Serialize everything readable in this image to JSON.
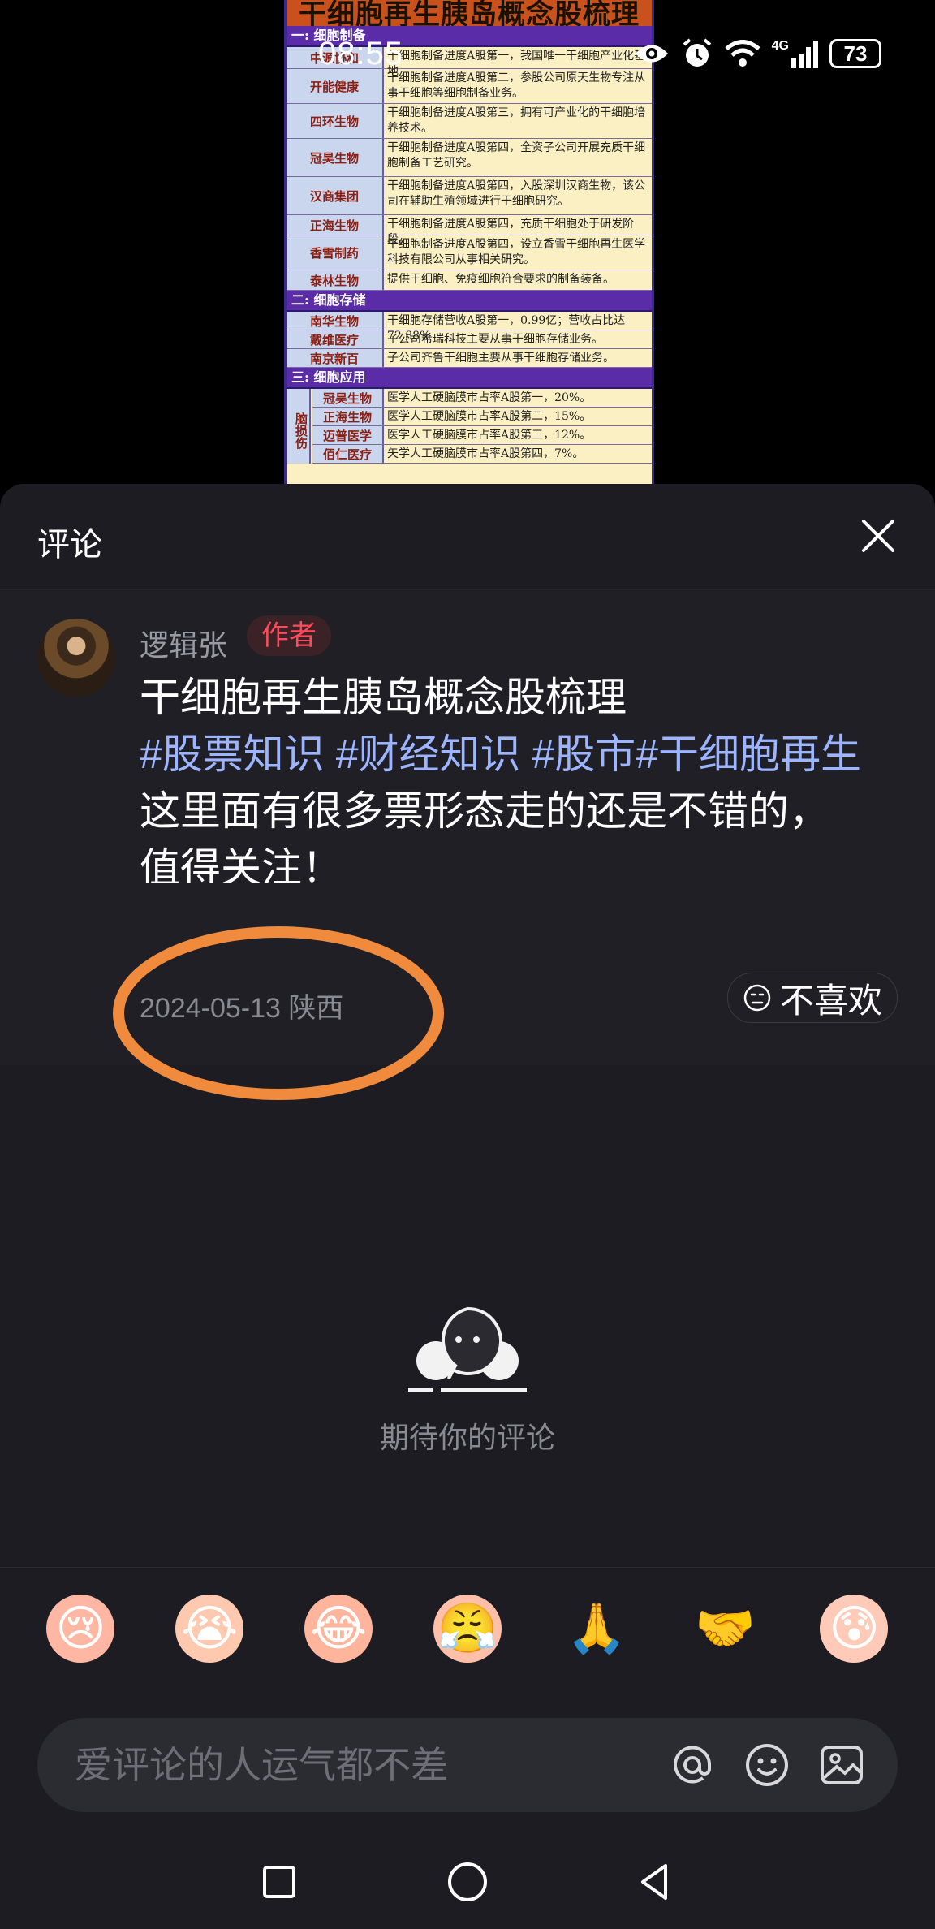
{
  "status_bar": {
    "time": "08:55",
    "network": "4G",
    "battery": "73"
  },
  "image": {
    "title": "干细胞再生胰岛概念股梳理",
    "sections": [
      {
        "label": "一: 细胞制备",
        "rows": [
          {
            "name": "中源协和",
            "desc": "干细胞制备进度A股第一，我国唯一干细胞产业化基地"
          },
          {
            "name": "开能健康",
            "desc": "干细胞制备进度A股第二，参股公司原天生物专注从事干细胞等细胞制备业务。"
          },
          {
            "name": "四环生物",
            "desc": "干细胞制备进度A股第三，拥有可产业化的干细胞培养技术。"
          },
          {
            "name": "冠昊生物",
            "desc": "干细胞制备进度A股第四，全资子公司开展充质干细胞制备工艺研究。"
          },
          {
            "name": "汉商集团",
            "desc": "干细胞制备进度A股第四，入股深圳汉商生物，该公司在辅助生殖领域进行干细胞研究。"
          },
          {
            "name": "正海生物",
            "desc": "干细胞制备进度A股第四，充质干细胞处于研发阶段。"
          },
          {
            "name": "香雪制药",
            "desc": "干细胞制备进度A股第四，设立香雪干细胞再生医学科技有限公司从事相关研究。"
          },
          {
            "name": "泰林生物",
            "desc": "提供干细胞、免疫细胞符合要求的制备装备。"
          }
        ]
      },
      {
        "label": "二: 细胞存储",
        "rows": [
          {
            "name": "南华生物",
            "desc": "干细胞存储营收A股第一，0.99亿；营收占比达72.88%"
          },
          {
            "name": "戴维医疗",
            "desc": "子公司希瑞科技主要从事干细胞存储业务。"
          },
          {
            "name": "南京新百",
            "desc": "子公司齐鲁干细胞主要从事干细胞存储业务。"
          }
        ]
      },
      {
        "label": "三: 细胞应用",
        "side_label": "脑损伤",
        "rows": [
          {
            "name": "冠昊生物",
            "desc": "医学人工硬脑膜市占率A股第一，20%。"
          },
          {
            "name": "正海生物",
            "desc": "医学人工硬脑膜市占率A股第二，15%。"
          },
          {
            "name": "迈普医学",
            "desc": "医学人工硬脑膜市占率A股第三，12%。"
          },
          {
            "name": "佰仁医疗",
            "desc": "矢学人工硬脑膜市占率A股第四，7%。"
          }
        ]
      }
    ]
  },
  "panel": {
    "title": "评论",
    "close_icon": "close-icon"
  },
  "comment": {
    "author": "逻辑张",
    "badge": "作者",
    "text_line1": "干细胞再生胰岛概念股梳理",
    "hashtags": "#股票知识 #财经知识 #股市#干细胞再生",
    "text_line3": "这里面有很多票形态走的还是不错的，",
    "text_line4": "值得关注！",
    "date": "2024-05-13",
    "location": "陕西",
    "dislike_label": "不喜欢"
  },
  "empty_state": {
    "text": "期待你的评论"
  },
  "emojis": [
    "crying-emoji",
    "sobbing-emoji",
    "tears-emoji",
    "angry-emoji",
    "pray-emoji",
    "handshake-emoji",
    "nervous-emoji"
  ],
  "input": {
    "placeholder": "爱评论的人运气都不差"
  },
  "colors": {
    "panel_bg": "#1c1c22",
    "accent_hashtag": "#9db4ff",
    "badge_red": "#ff4a5c",
    "highlight_orange": "#f08a3c"
  }
}
